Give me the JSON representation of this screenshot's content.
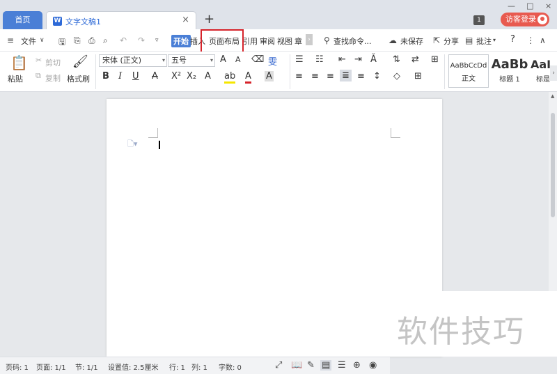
{
  "tabs": {
    "home": "首页",
    "document": "文字文稿1",
    "close": "×",
    "add": "+"
  },
  "window": {
    "minimize": "—",
    "maximize": "□",
    "close": "×",
    "badge": "1",
    "login": "访客登录"
  },
  "menu": {
    "file": "文件",
    "start": "开始",
    "insert": "插入",
    "page_layout": "页面布局",
    "references": "引用",
    "review": "审阅",
    "view": "视图",
    "chapter": "章",
    "search": "查找命令...",
    "unsaved": "未保存",
    "share": "分享",
    "comment": "批注",
    "help": "?"
  },
  "ribbon": {
    "paste": "粘贴",
    "cut": "剪切",
    "copy": "复制",
    "format_painter": "格式刷",
    "font_name": "宋体 (正文)",
    "font_size": "五号",
    "styles": [
      {
        "preview": "AaBbCcDd",
        "label": "正文"
      },
      {
        "preview": "AaBb",
        "label": "标题 1"
      },
      {
        "preview": "AaI",
        "label": "标是"
      }
    ]
  },
  "status": {
    "page_number": "页码: 1",
    "pages": "页面: 1/1",
    "section": "节: 1/1",
    "setting": "设置值: 2.5厘米",
    "row": "行: 1",
    "column": "列: 1",
    "word_count": "字数: 0"
  },
  "watermark": "软件技巧",
  "colors": {
    "accent": "#4a7fd6",
    "login": "#e85a4f",
    "highlight": "#d6232a"
  }
}
